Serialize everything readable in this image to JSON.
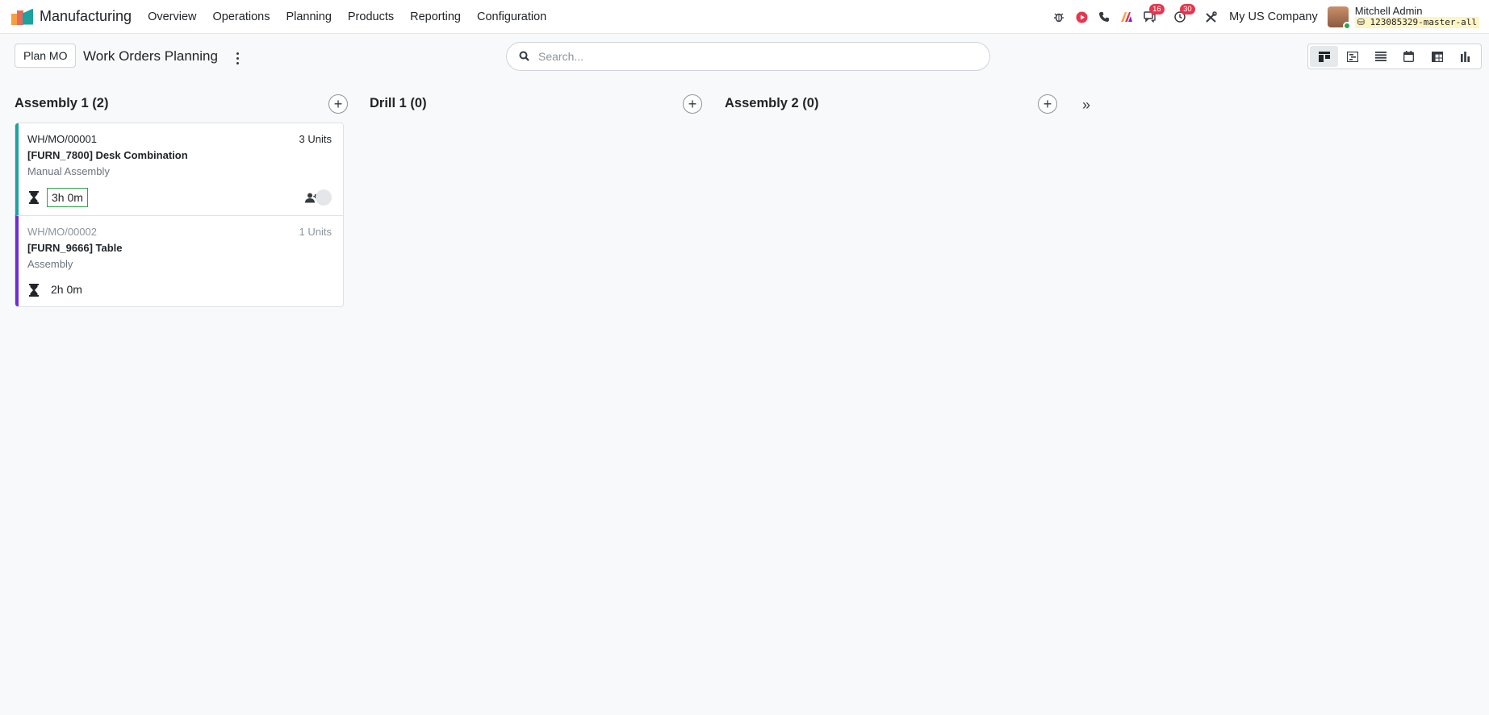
{
  "navbar": {
    "app_name": "Manufacturing",
    "menu": [
      "Overview",
      "Operations",
      "Planning",
      "Products",
      "Reporting",
      "Configuration"
    ],
    "badges": {
      "messages": "16",
      "activities": "30"
    },
    "company": "My US Company",
    "user": {
      "name": "Mitchell Admin",
      "database": "123085329-master-all"
    }
  },
  "control_panel": {
    "plan_button": "Plan MO",
    "title": "Work Orders Planning",
    "search_placeholder": "Search...",
    "views": [
      "kanban-icon",
      "gantt-icon",
      "list-icon",
      "calendar-icon",
      "pivot-icon",
      "graph-icon"
    ],
    "active_view": "kanban"
  },
  "columns": [
    {
      "title": "Assembly 1 (2)",
      "cards": [
        {
          "ref": "WH/MO/00001",
          "qty": "3 Units",
          "product": "[FURN_7800] Desk Combination",
          "workcenter": "Manual Assembly",
          "duration": "3h 0m",
          "color": "#1aa3a0"
        },
        {
          "ref": "WH/MO/00002",
          "qty": "1 Units",
          "product": "[FURN_9666] Table",
          "workcenter": "Assembly",
          "duration": "2h 0m",
          "color": "#6f2cd6"
        }
      ]
    },
    {
      "title": "Drill 1 (0)",
      "cards": []
    },
    {
      "title": "Assembly 2 (0)",
      "cards": []
    }
  ],
  "fold_label": "»"
}
